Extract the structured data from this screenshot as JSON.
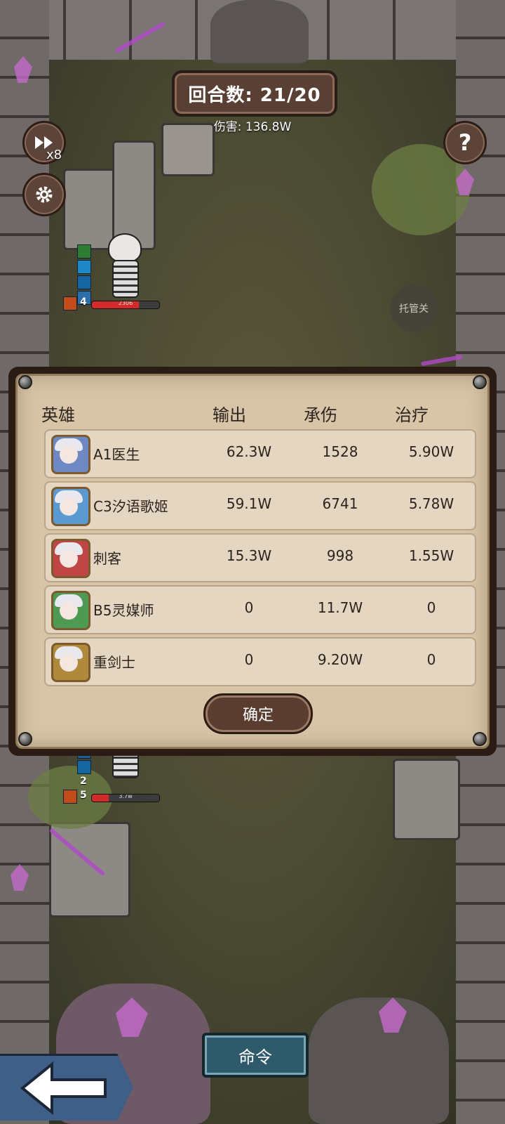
{
  "hud": {
    "round_label": "回合数: 21/20",
    "damage_label": "伤害: 136.8W",
    "speed_multiplier": "x8",
    "help_icon_text": "?",
    "auto_label": "托管关"
  },
  "enemy": {
    "level": "4",
    "hp_text": "2306",
    "hp_fraction": 0.7
  },
  "ally": {
    "level": "5",
    "buff_count": "2",
    "hp_text": "3.7w",
    "hp_fraction": 0.25
  },
  "stats": {
    "headers": [
      "英雄",
      "输出",
      "承伤",
      "治疗"
    ],
    "rows": [
      {
        "name": "A1医生",
        "output": "62.3W",
        "taken": "1528",
        "heal": "5.90W",
        "color": "#6e88c4"
      },
      {
        "name": "C3汐语歌姬",
        "output": "59.1W",
        "taken": "6741",
        "heal": "5.78W",
        "color": "#5a9ad0"
      },
      {
        "name": "刺客",
        "output": "15.3W",
        "taken": "998",
        "heal": "1.55W",
        "color": "#c04646"
      },
      {
        "name": "B5灵媒师",
        "output": "0",
        "taken": "11.7W",
        "heal": "0",
        "color": "#4f9a52"
      },
      {
        "name": "重剑士",
        "output": "0",
        "taken": "9.20W",
        "heal": "0",
        "color": "#b08a3c"
      }
    ],
    "confirm_label": "确定"
  },
  "bottom": {
    "command_label": "命令"
  }
}
